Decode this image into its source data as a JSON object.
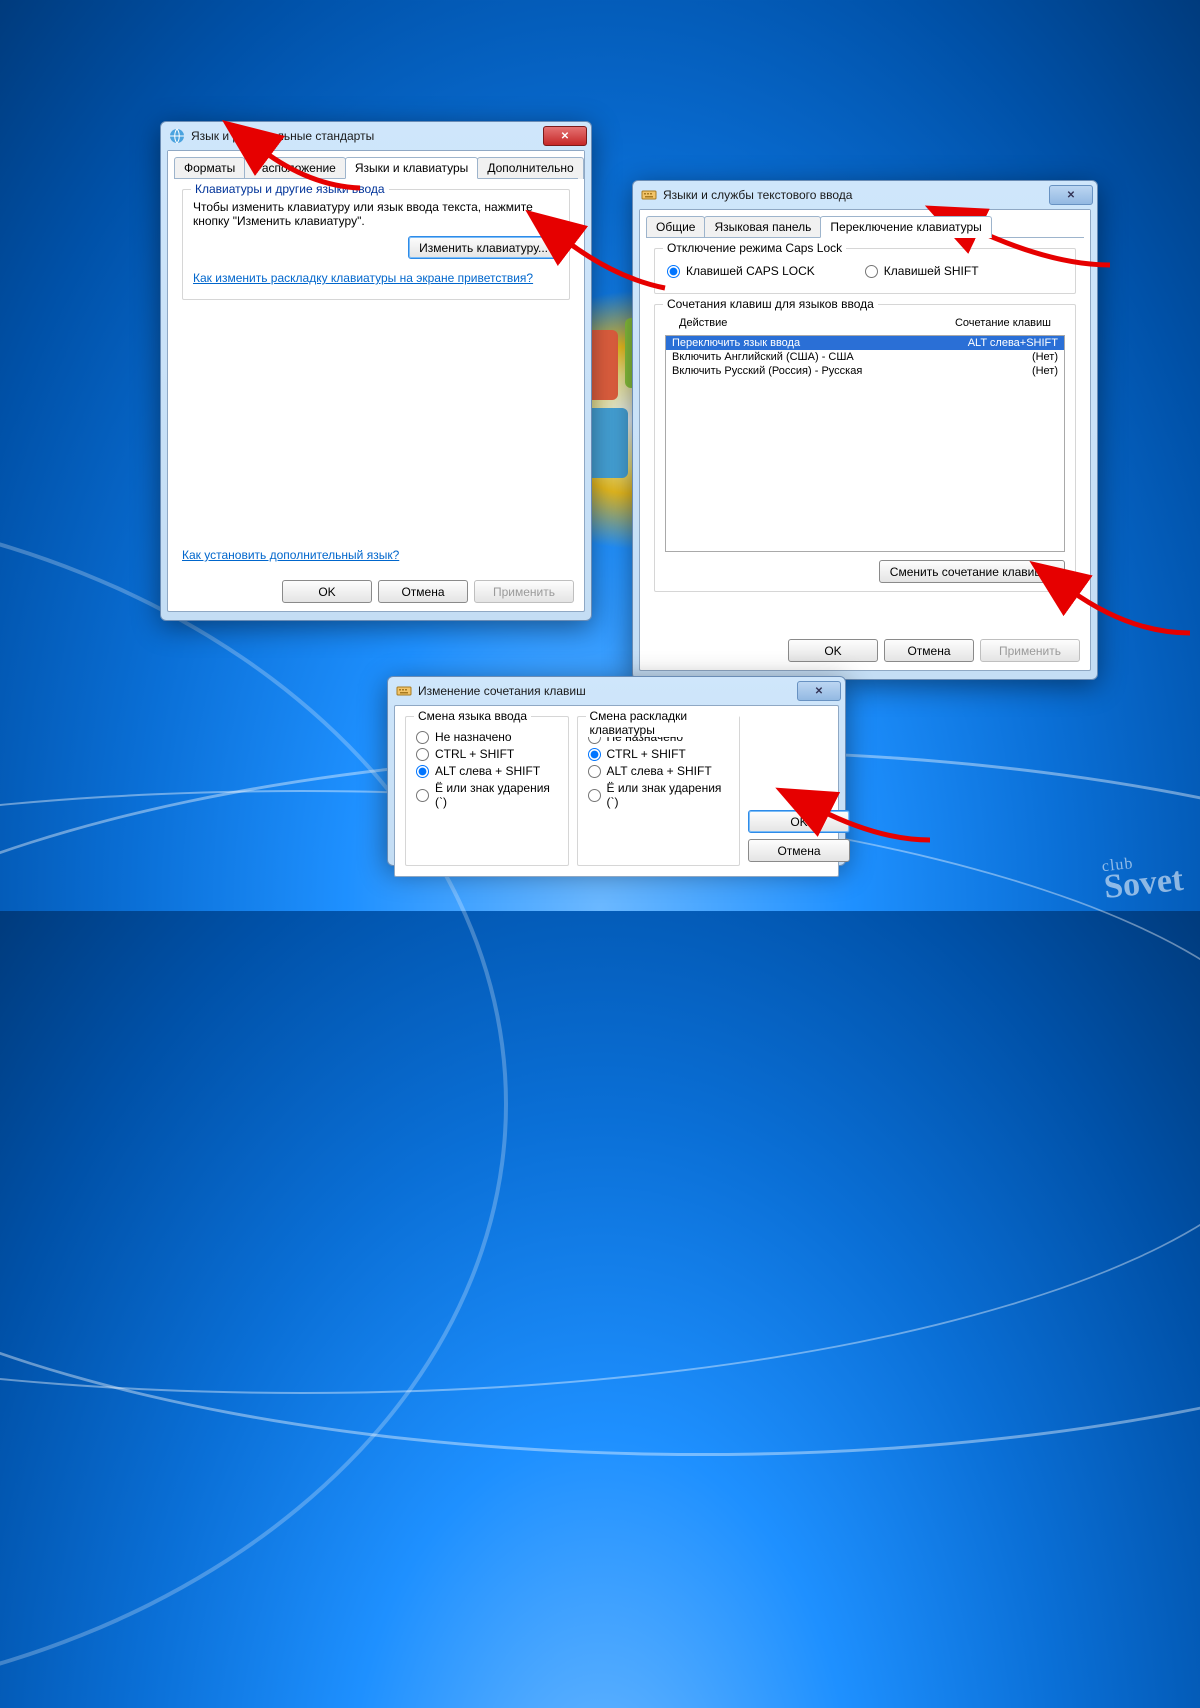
{
  "win1": {
    "title": "Язык и региональные стандарты",
    "tabs": [
      "Форматы",
      "Расположение",
      "Языки и клавиатуры",
      "Дополнительно"
    ],
    "activeTab": 2,
    "group_title": "Клавиатуры и другие языки ввода",
    "group_text": "Чтобы изменить клавиатуру или язык ввода текста, нажмите кнопку \"Изменить клавиатуру\".",
    "button_change": "Изменить клавиатуру...",
    "link1": "Как изменить раскладку клавиатуры на экране приветствия?",
    "link2": "Как установить дополнительный язык?",
    "ok": "OK",
    "cancel": "Отмена",
    "apply": "Применить"
  },
  "win2": {
    "title": "Языки и службы текстового ввода",
    "tabs": [
      "Общие",
      "Языковая панель",
      "Переключение клавиатуры"
    ],
    "activeTab": 2,
    "caps_group": "Отключение режима Caps Lock",
    "caps_radio1": "Клавишей CAPS LOCK",
    "caps_radio2": "Клавишей SHIFT",
    "hotkeys_group": "Сочетания клавиш для языков ввода",
    "col_action": "Действие",
    "col_keys": "Сочетание клавиш",
    "rows": [
      {
        "action": "Переключить язык ввода",
        "keys": "ALT слева+SHIFT",
        "sel": true
      },
      {
        "action": "Включить Английский (США) - США",
        "keys": "(Нет)",
        "sel": false
      },
      {
        "action": "Включить Русский (Россия) - Русская",
        "keys": "(Нет)",
        "sel": false
      }
    ],
    "button_change": "Сменить сочетание клавиш...",
    "ok": "OK",
    "cancel": "Отмена",
    "apply": "Применить"
  },
  "win3": {
    "title": "Изменение сочетания клавиш",
    "g1_title": "Смена языка ввода",
    "g2_title": "Смена раскладки клавиатуры",
    "r_none": "Не назначено",
    "r_ctrl": "CTRL + SHIFT",
    "r_alt": "ALT слева + SHIFT",
    "r_e": "Ё или знак ударения (`)",
    "ok": "OK",
    "cancel": "Отмена"
  }
}
